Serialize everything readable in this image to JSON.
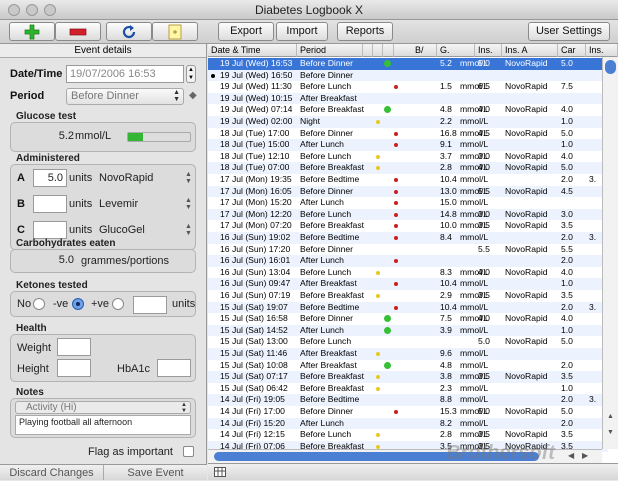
{
  "window": {
    "title": "Diabetes Logbook X"
  },
  "toolbar": {
    "export": "Export",
    "import": "Import",
    "reports": "Reports",
    "user_settings": "User Settings"
  },
  "event": {
    "header": "Event details",
    "datetime_label": "Date/Time",
    "datetime_value": "19/07/2006 16:53",
    "period_label": "Period",
    "period_value": "Before Dinner",
    "glucose_label": "Glucose test",
    "glucose_value": "5.2",
    "glucose_unit": "mmol/L",
    "administered_label": "Administered",
    "insulin": [
      {
        "letter": "A",
        "value": "5.0",
        "units": "units",
        "type": "NovoRapid"
      },
      {
        "letter": "B",
        "value": "",
        "units": "units",
        "type": "Levemir"
      },
      {
        "letter": "C",
        "value": "",
        "units": "units",
        "type": "GlucoGel"
      }
    ],
    "carbs_label": "Carbohydrates eaten",
    "carbs_value": "5.0",
    "carbs_unit": "grammes/portions",
    "ketones_label": "Ketones tested",
    "ketones_no": "No",
    "ketones_neg": "-ve",
    "ketones_pos": "+ve",
    "ketones_units": "units",
    "ketones_selected": "-ve",
    "health_label": "Health",
    "weight_label": "Weight",
    "height_label": "Height",
    "hba1c_label": "HbA1c",
    "notes_label": "Notes",
    "notes_category": "Activity (Hi)",
    "notes_text": "Playing football all afternoon",
    "flag_label": "Flag as important",
    "discard": "Discard Changes",
    "save": "Save Event"
  },
  "table": {
    "columns": [
      "Date & Time",
      "Period",
      "B/",
      "G.",
      "Ins.",
      "Ins. A",
      "Car",
      "Ins."
    ],
    "rows": [
      {
        "dt": "19 Jul (Wed) 16:53",
        "period": "Before Dinner",
        "mark": "apple",
        "b": "",
        "g": "5.2",
        "unit": "mmol/L",
        "ins": "5.0",
        "ins_a": "NovoRapid",
        "car": "5.0",
        "ins2": "",
        "selected": true
      },
      {
        "dt": "19 Jul (Wed) 16:50",
        "period": "Before Dinner",
        "mark": "",
        "b": "",
        "g": "",
        "unit": "",
        "ins": "",
        "ins_a": "",
        "car": "",
        "ins2": "",
        "bullet": true
      },
      {
        "dt": "19 Jul (Wed) 11:30",
        "period": "Before Lunch",
        "mark": "red",
        "b": "",
        "g": "1.5",
        "unit": "mmol/L",
        "ins": "6.5",
        "ins_a": "NovoRapid",
        "car": "7.5",
        "ins2": ""
      },
      {
        "dt": "19 Jul (Wed) 10:15",
        "period": "After Breakfast",
        "mark": "",
        "b": "",
        "g": "",
        "unit": "",
        "ins": "",
        "ins_a": "",
        "car": "",
        "ins2": ""
      },
      {
        "dt": "19 Jul (Wed) 07:14",
        "period": "Before Breakfast",
        "mark": "apple",
        "b": "",
        "g": "4.8",
        "unit": "mmol/L",
        "ins": "4.0",
        "ins_a": "NovoRapid",
        "car": "4.0",
        "ins2": ""
      },
      {
        "dt": "19 Jul (Wed) 02:00",
        "period": "Night",
        "mark": "yellow",
        "b": "",
        "g": "2.2",
        "unit": "mmol/L",
        "ins": "",
        "ins_a": "",
        "car": "1.0",
        "ins2": ""
      },
      {
        "dt": "18 Jul (Tue) 17:00",
        "period": "Before Dinner",
        "mark": "red",
        "b": "",
        "g": "16.8",
        "unit": "mmol/L",
        "ins": "4.5",
        "ins_a": "NovoRapid",
        "car": "5.0",
        "ins2": ""
      },
      {
        "dt": "18 Jul (Tue) 15:00",
        "period": "After Lunch",
        "mark": "red",
        "b": "",
        "g": "9.1",
        "unit": "mmol/L",
        "ins": "",
        "ins_a": "",
        "car": "1.0",
        "ins2": ""
      },
      {
        "dt": "18 Jul (Tue) 12:10",
        "period": "Before Lunch",
        "mark": "yellow",
        "b": "",
        "g": "3.7",
        "unit": "mmol/L",
        "ins": "3.0",
        "ins_a": "NovoRapid",
        "car": "4.0",
        "ins2": ""
      },
      {
        "dt": "18 Jul (Tue) 07:00",
        "period": "Before Breakfast",
        "mark": "yellow",
        "b": "",
        "g": "2.8",
        "unit": "mmol/L",
        "ins": "4.0",
        "ins_a": "NovoRapid",
        "car": "5.0",
        "ins2": ""
      },
      {
        "dt": "17 Jul (Mon) 19:35",
        "period": "Before Bedtime",
        "mark": "red",
        "b": "",
        "g": "10.4",
        "unit": "mmol/L",
        "ins": "",
        "ins_a": "",
        "car": "2.0",
        "ins2": "3."
      },
      {
        "dt": "17 Jul (Mon) 16:05",
        "period": "Before Dinner",
        "mark": "red",
        "b": "",
        "g": "13.0",
        "unit": "mmol/L",
        "ins": "5.5",
        "ins_a": "NovoRapid",
        "car": "4.5",
        "ins2": ""
      },
      {
        "dt": "17 Jul (Mon) 15:20",
        "period": "After Lunch",
        "mark": "red",
        "b": "",
        "g": "15.0",
        "unit": "mmol/L",
        "ins": "",
        "ins_a": "",
        "car": "",
        "ins2": ""
      },
      {
        "dt": "17 Jul (Mon) 12:20",
        "period": "Before Lunch",
        "mark": "red",
        "b": "",
        "g": "14.8",
        "unit": "mmol/L",
        "ins": "3.0",
        "ins_a": "NovoRapid",
        "car": "3.0",
        "ins2": ""
      },
      {
        "dt": "17 Jul (Mon) 07:20",
        "period": "Before Breakfast",
        "mark": "red",
        "b": "",
        "g": "10.0",
        "unit": "mmol/L",
        "ins": "3.5",
        "ins_a": "NovoRapid",
        "car": "3.5",
        "ins2": ""
      },
      {
        "dt": "16 Jul (Sun) 19:02",
        "period": "Before Bedtime",
        "mark": "red",
        "b": "",
        "g": "8.4",
        "unit": "mmol/L",
        "ins": "",
        "ins_a": "",
        "car": "2.0",
        "ins2": "3."
      },
      {
        "dt": "16 Jul (Sun) 17:20",
        "period": "Before Dinner",
        "mark": "",
        "b": "",
        "g": "",
        "unit": "",
        "ins": "5.5",
        "ins_a": "NovoRapid",
        "car": "5.5",
        "ins2": ""
      },
      {
        "dt": "16 Jul (Sun) 16:01",
        "period": "After Lunch",
        "mark": "red",
        "b": "",
        "g": "",
        "unit": "",
        "ins": "",
        "ins_a": "",
        "car": "2.0",
        "ins2": ""
      },
      {
        "dt": "16 Jul (Sun) 13:04",
        "period": "Before Lunch",
        "mark": "yellow",
        "b": "",
        "g": "8.3",
        "unit": "mmol/L",
        "ins": "4.0",
        "ins_a": "NovoRapid",
        "car": "4.0",
        "ins2": ""
      },
      {
        "dt": "16 Jul (Sun) 09:47",
        "period": "After Breakfast",
        "mark": "red",
        "b": "",
        "g": "10.4",
        "unit": "mmol/L",
        "ins": "",
        "ins_a": "",
        "car": "1.0",
        "ins2": ""
      },
      {
        "dt": "16 Jul (Sun) 07:19",
        "period": "Before Breakfast",
        "mark": "yellow",
        "b": "",
        "g": "2.9",
        "unit": "mmol/L",
        "ins": "3.5",
        "ins_a": "NovoRapid",
        "car": "3.5",
        "ins2": ""
      },
      {
        "dt": "15 Jul (Sat) 19:07",
        "period": "Before Bedtime",
        "mark": "red",
        "b": "",
        "g": "10.4",
        "unit": "mmol/L",
        "ins": "",
        "ins_a": "",
        "car": "2.0",
        "ins2": "3."
      },
      {
        "dt": "15 Jul (Sat) 16:58",
        "period": "Before Dinner",
        "mark": "apple",
        "b": "",
        "g": "7.5",
        "unit": "mmol/L",
        "ins": "4.0",
        "ins_a": "NovoRapid",
        "car": "4.0",
        "ins2": ""
      },
      {
        "dt": "15 Jul (Sat) 14:52",
        "period": "After Lunch",
        "mark": "apple",
        "b": "",
        "g": "3.9",
        "unit": "mmol/L",
        "ins": "",
        "ins_a": "",
        "car": "1.0",
        "ins2": ""
      },
      {
        "dt": "15 Jul (Sat) 13:00",
        "period": "Before Lunch",
        "mark": "",
        "b": "",
        "g": "",
        "unit": "",
        "ins": "5.0",
        "ins_a": "NovoRapid",
        "car": "5.0",
        "ins2": ""
      },
      {
        "dt": "15 Jul (Sat) 11:46",
        "period": "After Breakfast",
        "mark": "yellow",
        "b": "",
        "g": "9.6",
        "unit": "mmol/L",
        "ins": "",
        "ins_a": "",
        "car": "",
        "ins2": ""
      },
      {
        "dt": "15 Jul (Sat) 10:08",
        "period": "After Breakfast",
        "mark": "apple",
        "b": "",
        "g": "4.8",
        "unit": "mmol/L",
        "ins": "",
        "ins_a": "",
        "car": "2.0",
        "ins2": ""
      },
      {
        "dt": "15 Jul (Sat) 07:17",
        "period": "Before Breakfast",
        "mark": "yellow",
        "b": "",
        "g": "3.8",
        "unit": "mmol/L",
        "ins": "3.5",
        "ins_a": "NovoRapid",
        "car": "3.5",
        "ins2": ""
      },
      {
        "dt": "15 Jul (Sat) 06:42",
        "period": "Before Breakfast",
        "mark": "yellow",
        "b": "",
        "g": "2.3",
        "unit": "mmol/L",
        "ins": "",
        "ins_a": "",
        "car": "1.0",
        "ins2": ""
      },
      {
        "dt": "14 Jul (Fri) 19:05",
        "period": "Before Bedtime",
        "mark": "",
        "b": "",
        "g": "8.8",
        "unit": "mmol/L",
        "ins": "",
        "ins_a": "",
        "car": "2.0",
        "ins2": "3."
      },
      {
        "dt": "14 Jul (Fri) 17:00",
        "period": "Before Dinner",
        "mark": "red",
        "b": "",
        "g": "15.3",
        "unit": "mmol/L",
        "ins": "5.0",
        "ins_a": "NovoRapid",
        "car": "5.0",
        "ins2": ""
      },
      {
        "dt": "14 Jul (Fri) 15:20",
        "period": "After Lunch",
        "mark": "",
        "b": "",
        "g": "8.2",
        "unit": "mmol/L",
        "ins": "",
        "ins_a": "",
        "car": "2.0",
        "ins2": ""
      },
      {
        "dt": "14 Jul (Fri) 12:15",
        "period": "Before Lunch",
        "mark": "yellow",
        "b": "",
        "g": "2.8",
        "unit": "mmol/L",
        "ins": "3.5",
        "ins_a": "NovoRapid",
        "car": "3.5",
        "ins2": ""
      },
      {
        "dt": "14 Jul (Fri) 07:06",
        "period": "Before Breakfast",
        "mark": "yellow",
        "b": "",
        "g": "3.5",
        "unit": "mmol/L",
        "ins": "3.5",
        "ins_a": "NovoRapid",
        "car": "3.5",
        "ins2": ""
      }
    ]
  },
  "watermark": "Brothersoft",
  "colors": {
    "selection": "#3875d7",
    "alt_row": "#edf3fe",
    "add": "#2db52d",
    "remove": "#d0202b",
    "low": "#e8c820",
    "high": "#cc1f1f",
    "apple": "#35c035"
  }
}
